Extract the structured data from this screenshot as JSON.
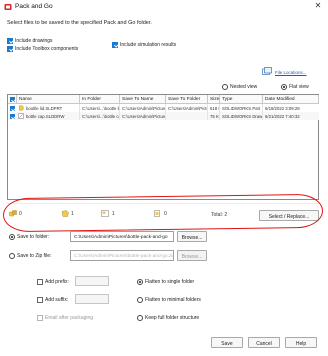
{
  "window": {
    "title": "Pack and Go",
    "close_glyph": "✕"
  },
  "instruction": "Select files to be saved to the specified Pack and Go folder.",
  "options": {
    "include_drawings": "Include drawings",
    "include_toolbox": "Include Toolbox components",
    "include_simulation": "Include simulation results"
  },
  "file_locations_link": "File Locations...",
  "view": {
    "nested": "Nested view",
    "flat": "Flat view",
    "selected": "flat"
  },
  "table": {
    "columns": [
      "Name",
      "In Folder",
      "Save To Name",
      "Save To Folder",
      "Size",
      "Type",
      "Date Modified"
    ],
    "rows": [
      [
        "bootlle lid.SLDPRT",
        "C:\\Users\\...\\bootle lid.SLDPRT",
        "C:\\Users\\Admin\\Pictures\\bottl",
        "C:\\Users\\Admin\\Pictu",
        "618 K",
        "SOLIDWORKS Part",
        "6/18/2022 3:09:28"
      ],
      [
        "bottle cap.SLDDRW",
        "C:\\Users\\...\\bottle cap.SLDDRW",
        "C:\\Users\\Admin\\Pictures",
        "",
        "75 KB",
        "SOLIDWORKS Drawing",
        "6/21/2022 7:40:32"
      ]
    ]
  },
  "summary": {
    "counts": [
      "0",
      "1",
      "1",
      "0"
    ],
    "icons": [
      "assembly-count-icon",
      "part-count-icon",
      "drawing-count-icon",
      "other-count-icon"
    ],
    "total_label": "Total: 2",
    "select_replace": "Select / Replace..."
  },
  "save": {
    "to_folder_label": "Save to folder:",
    "folder_path": "C:\\Users\\Admin\\Pictures\\bottle-pack-and-go",
    "to_zip_label": "Save to Zip file:",
    "zip_path": "C:\\Users\\Admin\\Pictures\\bottle-pack-and-go.zip",
    "browse": "Browse...",
    "selected": "folder"
  },
  "naming": {
    "add_prefix": "Add prefix:",
    "add_suffix": "Add suffix:",
    "email_after": "Email after packaging",
    "flatten_single": "Flatten to single folder",
    "flatten_minimal": "Flatten to minimal folders",
    "keep_structure": "Keep full folder structure",
    "selected": "single"
  },
  "buttons": {
    "save": "Save",
    "cancel": "Cancel",
    "help": "Help"
  },
  "colors": {
    "accent": "#1e78d0",
    "annotation": "#e01414"
  }
}
